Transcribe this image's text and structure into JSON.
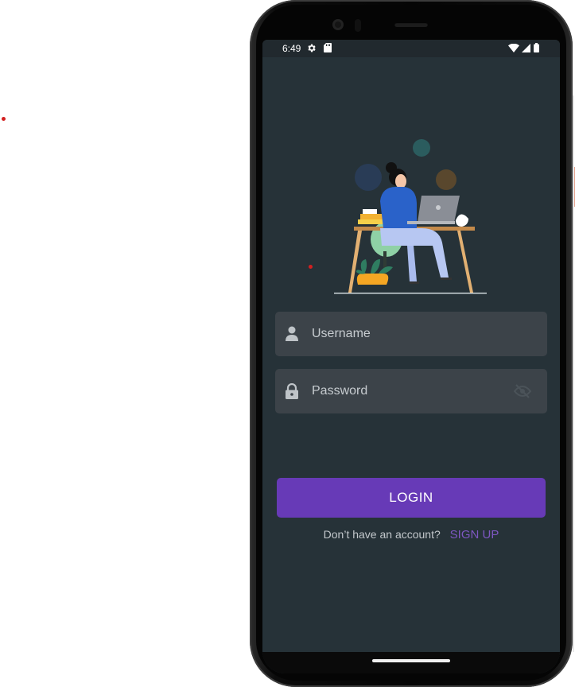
{
  "status_bar": {
    "time": "6:49",
    "icons": [
      "gear-icon",
      "sd-card-icon",
      "wifi-icon",
      "signal-icon",
      "battery-icon"
    ]
  },
  "illustration": {
    "name": "person-at-laptop-illustration"
  },
  "login_form": {
    "username": {
      "placeholder": "Username",
      "icon": "person-icon",
      "value": ""
    },
    "password": {
      "placeholder": "Password",
      "icon": "lock-icon",
      "toggle_icon": "eye-visibility-icon",
      "value": ""
    },
    "login_button": "LOGIN",
    "signup_prompt": "Don’t have an account?",
    "signup_link": "SIGN UP"
  },
  "colors": {
    "screen_background": "#263238",
    "field_background": "#3c4349",
    "accent": "#673ab7",
    "link": "#7e57c2"
  }
}
